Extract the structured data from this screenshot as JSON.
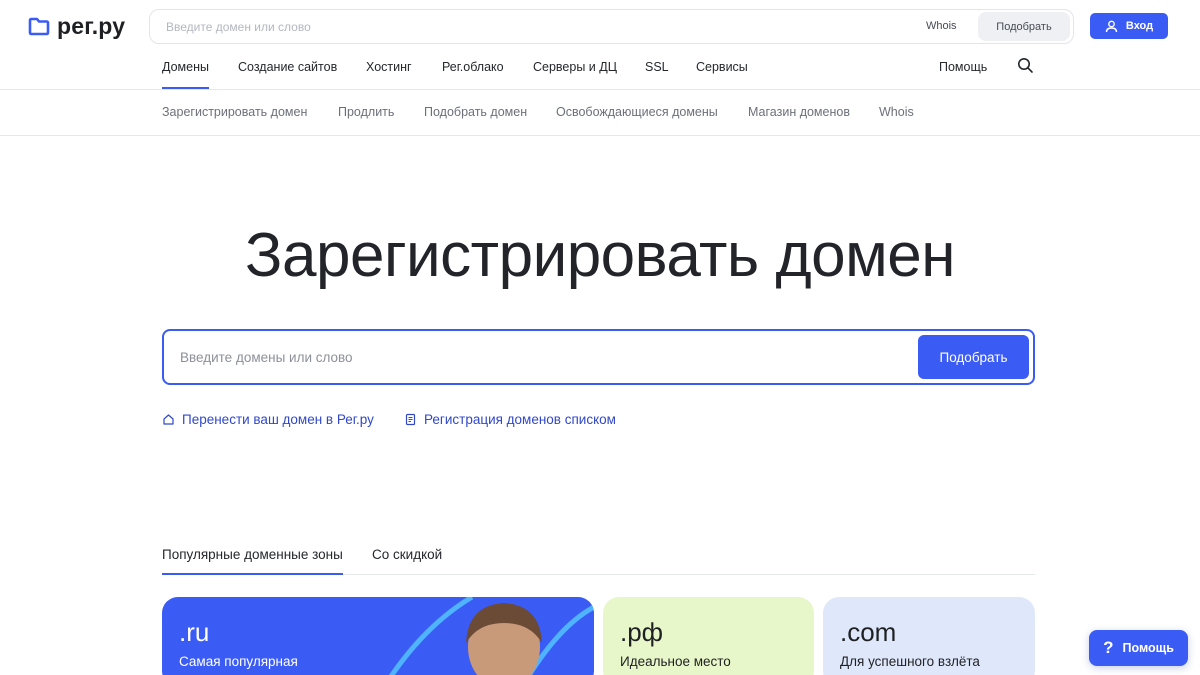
{
  "colors": {
    "accent": "#3b5bf5",
    "link": "#3048c9",
    "card_rf": "#e8f7c9",
    "card_com": "#dfe8fb"
  },
  "header": {
    "logo_text": "рег.ру",
    "search_placeholder": "Введите домен или слово",
    "whois_label": "Whois",
    "pick_label": "Подобрать",
    "login_label": "Вход"
  },
  "mainnav": {
    "items": [
      {
        "label": "Домены"
      },
      {
        "label": "Создание сайтов"
      },
      {
        "label": "Хостинг"
      },
      {
        "label": "Рег.облако"
      },
      {
        "label": "Серверы и ДЦ"
      },
      {
        "label": "SSL"
      },
      {
        "label": "Сервисы"
      }
    ],
    "active_index": 0,
    "help_label": "Помощь",
    "search_icon": "search-icon"
  },
  "subnav": {
    "items": [
      {
        "label": "Зарегистрировать домен"
      },
      {
        "label": "Продлить"
      },
      {
        "label": "Подобрать домен"
      },
      {
        "label": "Освобождающиеся домены"
      },
      {
        "label": "Магазин доменов"
      },
      {
        "label": "Whois"
      }
    ]
  },
  "hero": {
    "title": "Зарегистрировать домен",
    "search_placeholder": "Введите домены или слово",
    "pick_label": "Подобрать",
    "links": [
      {
        "label": "Перенести ваш домен в Рег.ру",
        "icon": "home-icon"
      },
      {
        "label": "Регистрация доменов списком",
        "icon": "document-icon"
      }
    ]
  },
  "tabs": {
    "items": [
      {
        "label": "Популярные доменные зоны"
      },
      {
        "label": "Со скидкой"
      }
    ],
    "active_index": 0
  },
  "cards": [
    {
      "zone": ".ru",
      "desc": "Самая популярная"
    },
    {
      "zone": ".рф",
      "desc": "Идеальное место"
    },
    {
      "zone": ".com",
      "desc": "Для успешного взлёта"
    }
  ],
  "help_float": {
    "label": "Помощь",
    "icon": "?"
  }
}
